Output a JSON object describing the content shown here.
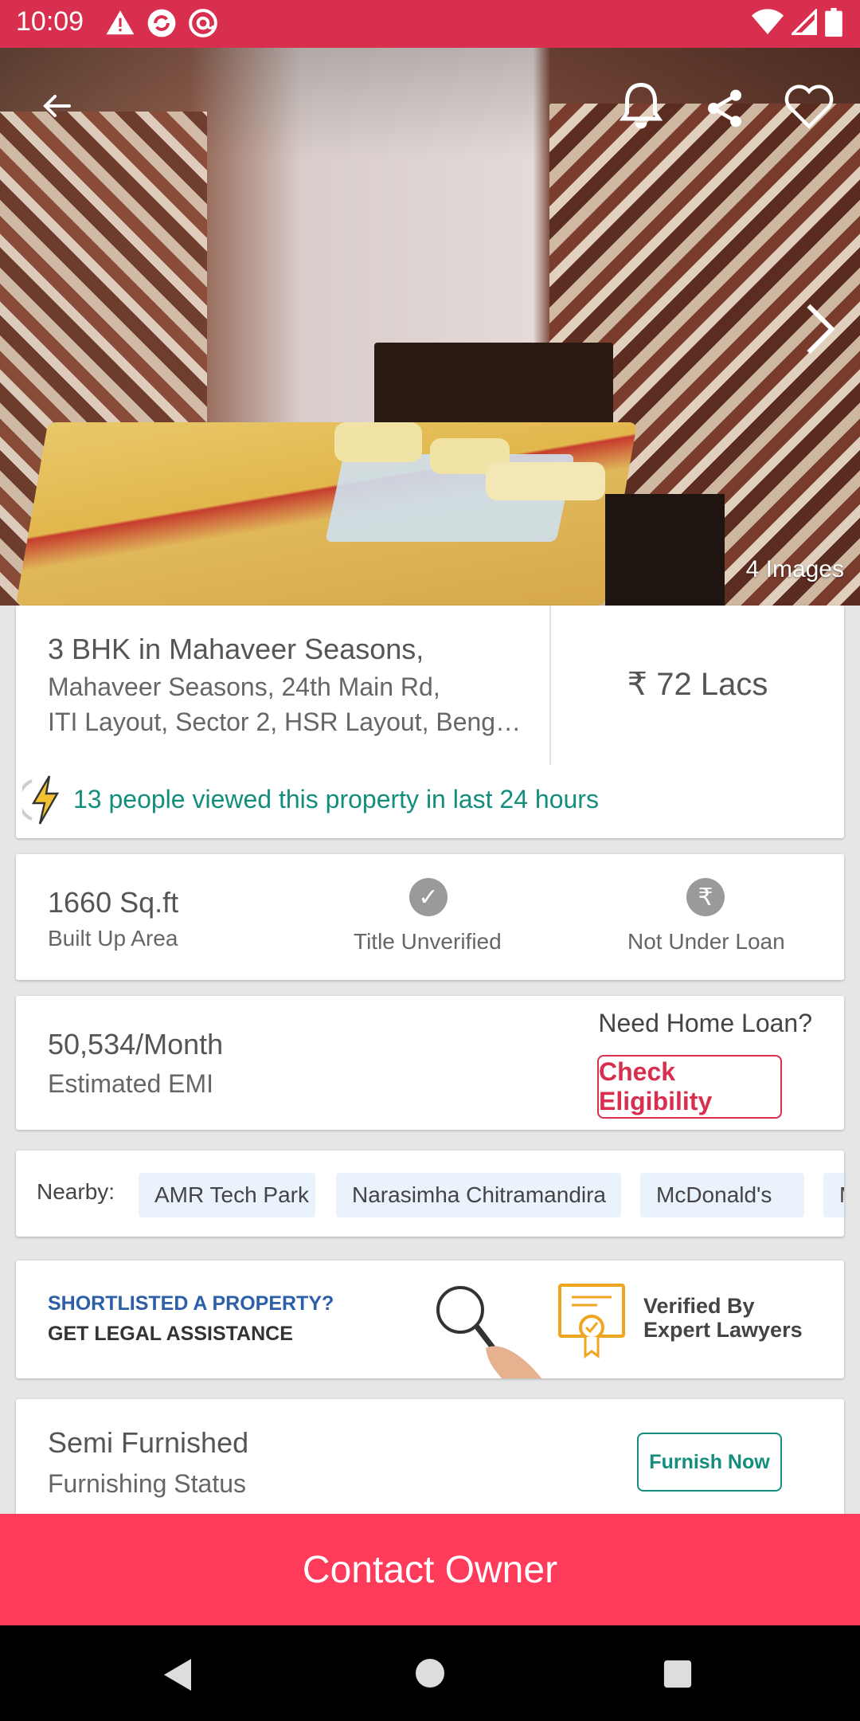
{
  "status_bar": {
    "time": "10:09",
    "icons": [
      "warning-icon",
      "sync-icon",
      "at-sign-icon",
      "wifi-icon",
      "signal-icon",
      "battery-icon"
    ]
  },
  "gallery": {
    "images_count": "4 Images",
    "actions": [
      "back-arrow-icon",
      "bell-icon",
      "share-icon",
      "heart-icon",
      "chevron-right-icon"
    ]
  },
  "property": {
    "title": "3 BHK in Mahaveer Seasons,",
    "address_line1": "Mahaveer Seasons, 24th Main Rd,",
    "address_line2": "ITI Layout, Sector 2, HSR Layout, Beng…",
    "price": "₹ 72 Lacs",
    "views_text": "13 people viewed this property in last 24 hours"
  },
  "details": {
    "area_value": "1660 Sq.ft",
    "area_label": "Built Up Area",
    "title_status": "Title Unverified",
    "loan_status": "Not Under Loan",
    "rupee_symbol": "₹"
  },
  "emi": {
    "value": "50,534/Month",
    "label": "Estimated EMI",
    "question": "Need Home Loan?",
    "button": "Check Eligibility"
  },
  "nearby": {
    "label": "Nearby:",
    "places": [
      "AMR Tech Park",
      "Narasimha Chitramandira",
      "McDonald's",
      "M"
    ]
  },
  "legal": {
    "question": "SHORTLISTED A PROPERTY?",
    "cta": "GET LEGAL ASSISTANCE",
    "verified_line1": "Verified By",
    "verified_line2": "Expert Lawyers"
  },
  "furnishing": {
    "value": "Semi Furnished",
    "label": "Furnishing Status",
    "button": "Furnish Now"
  },
  "contact_button": "Contact Owner",
  "colors": {
    "brand_red": "#fe3b5b",
    "status_bar": "#d92f4e",
    "teal": "#138d7c",
    "legal_blue": "#2d5fa8"
  }
}
